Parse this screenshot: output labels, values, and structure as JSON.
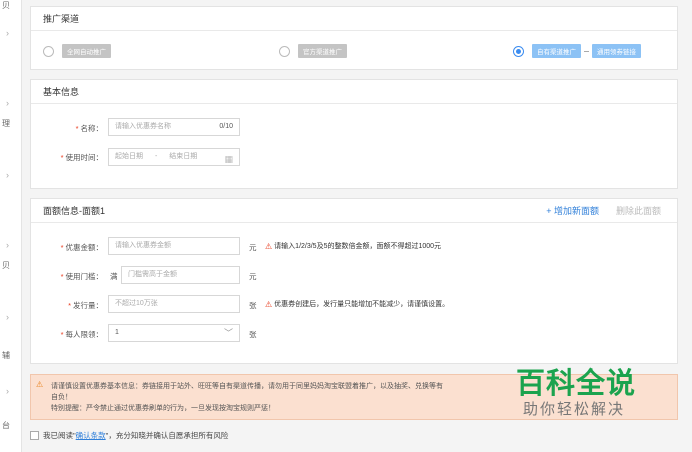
{
  "leftnav": {
    "items": [
      "贝",
      "理",
      "贝",
      "辅",
      "台"
    ]
  },
  "channel": {
    "title": "推广渠道",
    "options": [
      "全网自动推广",
      "官方渠道推广",
      "自有渠道推广"
    ],
    "selected_index": 2,
    "extra_tag": "通用领券链接"
  },
  "basic": {
    "title": "基本信息",
    "name_label": "名称：",
    "name_placeholder": "请输入优惠券名称",
    "name_count": "0/10",
    "time_label": "使用时间：",
    "start_placeholder": "起始日期",
    "time_sep": "-",
    "end_placeholder": "结束日期"
  },
  "face": {
    "title": "面额信息-面额1",
    "add_link": "+ 增加新面额",
    "delete_link": "删除此面额",
    "amount_label": "优惠金额：",
    "amount_placeholder": "请输入优惠券金额",
    "amount_unit": "元",
    "amount_warn": "请输入1/2/3/5及5的整数倍金额，面额不得超过1000元",
    "threshold_label": "使用门槛：",
    "threshold_prefix": "满",
    "threshold_placeholder": "门槛需高于金额",
    "threshold_unit": "元",
    "qty_label": "发行量：",
    "qty_placeholder": "不超过10万张",
    "qty_unit": "张",
    "qty_warn": "优惠券创建后，发行量只能增加不能减少，请谨慎设置。",
    "limit_label": "每人限领：",
    "limit_value": "1",
    "limit_unit": "张"
  },
  "notice": {
    "line1": "请谨慎设置优惠券基本信息：券链接用于站外、旺旺等自有渠道传播，请勿用于同里妈妈淘宝联盟着推广，以及抽奖、兑换等有",
    "line2": "自负！",
    "line3": "特别提醒：严令禁止通过优惠券刷单的行为，一旦发现按淘宝规则严惩！"
  },
  "watermark": {
    "title": "百科全说",
    "subtitle": "助你轻松解决"
  },
  "agree": {
    "prefix": "我已阅读\"",
    "link": "确认条款",
    "suffix": "\"，充分知晓并确认自愿承担所有风险"
  }
}
